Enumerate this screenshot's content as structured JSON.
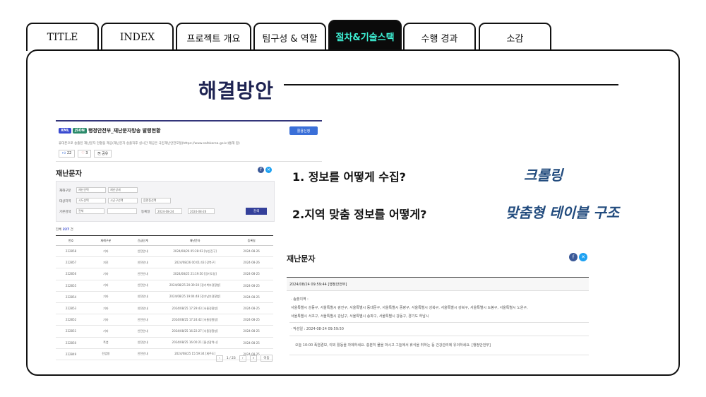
{
  "tabs": [
    {
      "label": "TITLE"
    },
    {
      "label": "INDEX"
    },
    {
      "label": "프로젝트 개요"
    },
    {
      "label": "팀구성 & 역할"
    },
    {
      "label": "절차&기술스택"
    },
    {
      "label": "수행 경과"
    },
    {
      "label": "소감"
    }
  ],
  "active_tab": "절차&기술스택",
  "colors": {
    "active_tab_bg": "#0b0b0b",
    "active_tab_text": "#3ef2d6",
    "title": "#1e2352",
    "answer": "#234c7e"
  },
  "page_title": "해결방안",
  "shot1": {
    "badge_xml": "XML",
    "badge_json": "JSON",
    "heading": "행정안전부_재난문자방송 발령현황",
    "button": "활용신청",
    "description": "휴대폰으로 송출된 재난문자 현황을 제공(재난문자 송출직후 실시간 제공은 국민재난안전포털(https://www.safekorea.go.kr)통해 함)",
    "like": "22",
    "heart": "3",
    "share": "공유"
  },
  "shot2": {
    "heading": "재난문자",
    "filters": {
      "row1_label": "재해구분",
      "row1_select1": "재난선택",
      "row1_select2": "재난상세",
      "row2_label": "대상지역",
      "row2_select1": "시도선택",
      "row2_select2": "시군구선택",
      "row2_select3": "읍면동선택",
      "row3_label": "기본검색",
      "row3_select": "전체",
      "date_label": "등록일",
      "date_from": "2024-08-24",
      "date_to": "2024-08-26",
      "search_button": "검색"
    },
    "count_prefix": "전체",
    "count_value": "227",
    "count_suffix": "건",
    "table_headers": [
      "번호",
      "재해구분",
      "긴급단계",
      "재난문자",
      "등록일"
    ],
    "rows": [
      [
        "222858",
        "기타",
        "안전안내",
        "2024/08/26 05:28:03 [부산진구]",
        "2024-08-26"
      ],
      [
        "222857",
        "지진",
        "안전안내",
        "2024/08/26 00:01:43 [강북구]",
        "2024-08-26"
      ],
      [
        "222856",
        "기타",
        "안전안내",
        "2024/08/25 21:19:50 [경기도청]",
        "2024-08-25"
      ],
      [
        "222855",
        "기타",
        "안전안내",
        "2024/08/25 20:39:30 [경기북부경찰청]",
        "2024-08-25"
      ],
      [
        "222854",
        "기타",
        "안전안내",
        "2024/08/25 19:04:48 [경기남부경찰청]",
        "2024-08-25"
      ],
      [
        "222853",
        "기타",
        "안전안내",
        "2024/08/25 17:29:43 [서울경찰청]",
        "2024-08-25"
      ],
      [
        "222852",
        "기타",
        "안전안내",
        "2024/08/25 17:24:42 [서울경찰청]",
        "2024-08-25"
      ],
      [
        "222851",
        "기타",
        "안전안내",
        "2024/08/25 16:22:27 [서울경찰청]",
        "2024-08-25"
      ],
      [
        "222850",
        "폭염",
        "안전안내",
        "2024/08/25 16:00:21 [울산광역시]",
        "2024-08-25"
      ],
      [
        "222849",
        "전염병",
        "안전안내",
        "2024/08/25 15:59:34 [제주도]",
        "2024-08-25"
      ]
    ],
    "pager": {
      "prev": "‹",
      "page": "1 / 23",
      "next": "›",
      "last": "»",
      "goto": "이동"
    }
  },
  "questions": [
    {
      "text": "1. 정보를 어떻게 수집?",
      "answer": "크롤링"
    },
    {
      "text": "2.지역 맞춤 정보를 어떻게?",
      "answer": "맞춤형 테이블 구조"
    }
  ],
  "shot3": {
    "heading": "재난문자",
    "meta": "2024/08/24 09:59:44 [행정안전부]",
    "areas_label": "· 송출지역 :",
    "areas_line1": "서울특별시 성동구, 서울특별시 광진구, 서울특별시 동대문구, 서울특별시 중랑구, 서울특별시 성북구, 서울특별시 강북구, 서울특별시 도봉구, 서울특별시 노원구,",
    "areas_line2": "서울특별시 서초구, 서울특별시 강남구, 서울특별시 송파구, 서울특별시 강동구, 경기도 하남시",
    "created": "· 작성일 : 2024-08-24 09:59:50",
    "message": "오늘 10:00 폭염경보, 야외 활동을 자제하세요. 충분히 물을 마시고 그늘에서 휴식을 취하는 등 건강관리에 유의하세요. [행정안전부]"
  },
  "social": {
    "facebook": "f",
    "twitter": "✕"
  }
}
